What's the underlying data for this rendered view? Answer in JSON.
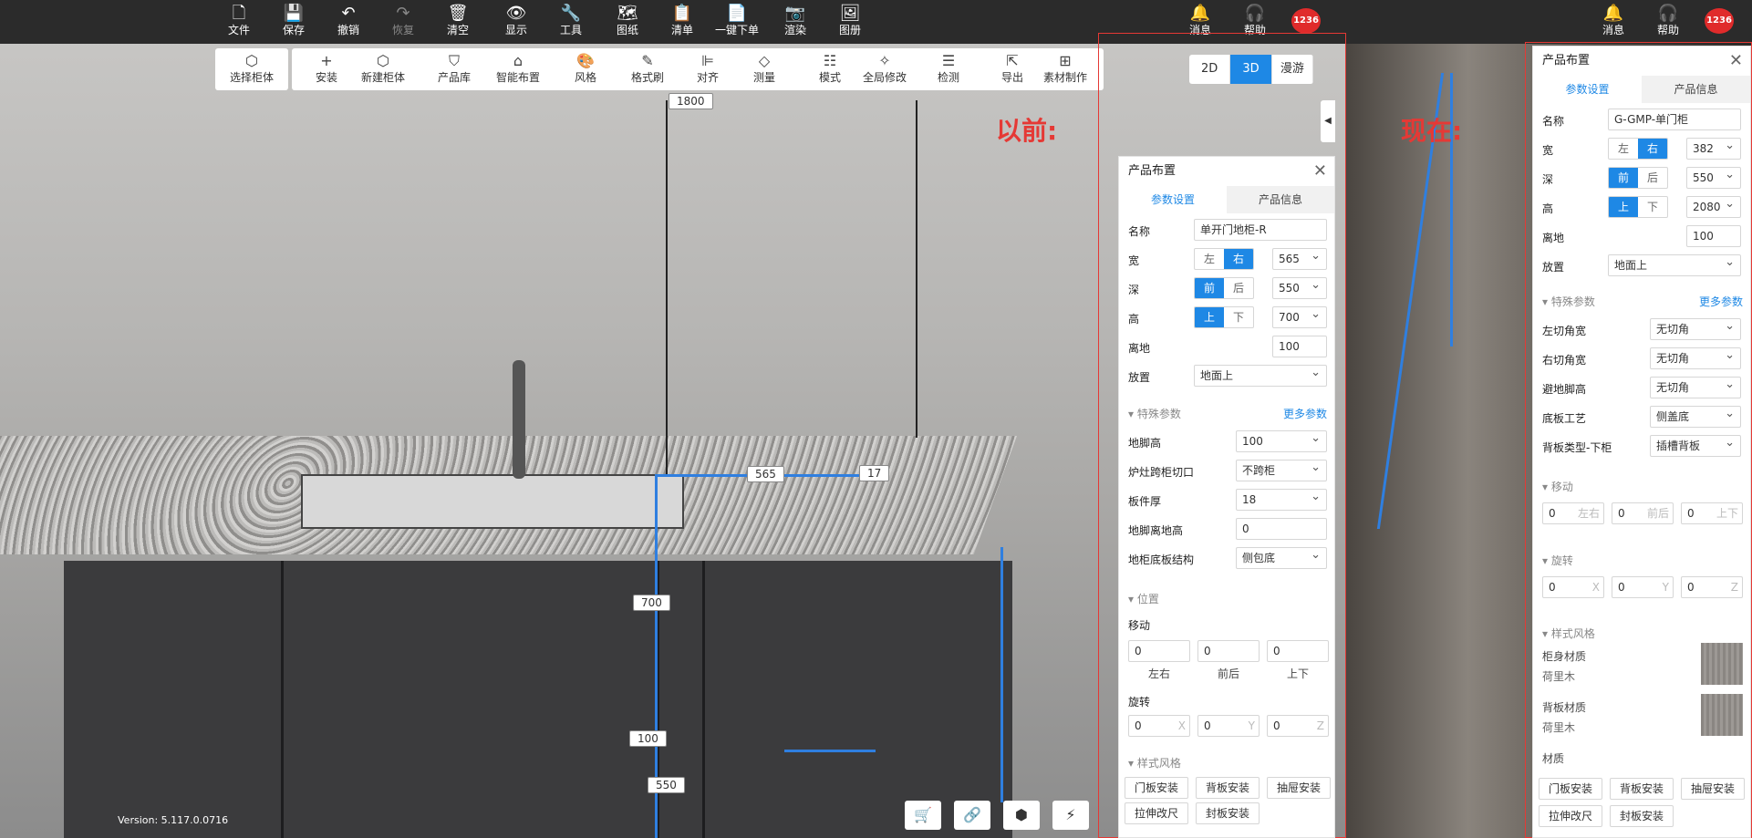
{
  "topbar": {
    "items": [
      {
        "label": "文件",
        "icon": "file-icon",
        "glyph": "🗋"
      },
      {
        "label": "保存",
        "icon": "save-icon",
        "glyph": "💾"
      },
      {
        "label": "撤销",
        "icon": "undo-icon",
        "glyph": "↶"
      },
      {
        "label": "恢复",
        "icon": "redo-icon",
        "glyph": "↷"
      },
      {
        "label": "清空",
        "icon": "trash-icon",
        "glyph": "🗑"
      },
      {
        "label": "显示",
        "icon": "eye-icon",
        "glyph": "👁"
      },
      {
        "label": "工具",
        "icon": "wrench-icon",
        "glyph": "🔧"
      },
      {
        "label": "图纸",
        "icon": "map-icon",
        "glyph": "🗺"
      },
      {
        "label": "清单",
        "icon": "clipboard-icon",
        "glyph": "📋"
      },
      {
        "label": "一键下单",
        "icon": "order-icon",
        "glyph": "📄"
      },
      {
        "label": "渲染",
        "icon": "camera-icon",
        "glyph": "📷"
      },
      {
        "label": "图册",
        "icon": "album-icon",
        "glyph": "🖼"
      }
    ],
    "right_left": [
      {
        "label": "消息",
        "icon": "bell-icon",
        "glyph": "🔔"
      },
      {
        "label": "帮助",
        "icon": "headset-icon",
        "glyph": "🎧"
      }
    ],
    "badge": "1236",
    "right_right": [
      {
        "label": "消息",
        "icon": "bell-icon",
        "glyph": "🔔"
      },
      {
        "label": "帮助",
        "icon": "headset-icon",
        "glyph": "🎧"
      }
    ],
    "badge2": "1236"
  },
  "subbar": {
    "select_cabinet": "选择柜体",
    "items": [
      "安装",
      "新建柜体",
      "产品库",
      "智能布置",
      "风格",
      "格式刷",
      "对齐",
      "测量",
      "模式",
      "全局修改",
      "检测",
      "导出",
      "素材制作"
    ],
    "glyphs": [
      "+",
      "⬡",
      "⛉",
      "⌂",
      "🎨",
      "✎",
      "⊫",
      "◇",
      "☷",
      "✧",
      "☰",
      "⇱",
      "⊞"
    ]
  },
  "view_toggle": {
    "options": [
      "2D",
      "3D",
      "漫游"
    ],
    "active": "3D"
  },
  "annotations": {
    "before": "以前:",
    "after": "现在:"
  },
  "dims": {
    "top": "1800",
    "width": "565",
    "small": "17",
    "height": "700",
    "ground": "100",
    "depth": "550"
  },
  "panel_old": {
    "title": "产品布置",
    "tabs": [
      "参数设置",
      "产品信息"
    ],
    "name_label": "名称",
    "name_value": "单开门地柜-R",
    "width_label": "宽",
    "width_seg": [
      "左",
      "右"
    ],
    "width_value": "565",
    "depth_label": "深",
    "depth_seg": [
      "前",
      "后"
    ],
    "depth_value": "550",
    "height_label": "高",
    "height_seg": [
      "上",
      "下"
    ],
    "height_value": "700",
    "ground_label": "离地",
    "ground_value": "100",
    "place_label": "放置",
    "place_value": "地面上",
    "special_title": "特殊参数",
    "more": "更多参数",
    "special": [
      {
        "k": "地脚高",
        "v": "100"
      },
      {
        "k": "炉灶跨柜切口",
        "v": "不跨柜"
      },
      {
        "k": "板件厚",
        "v": "18"
      },
      {
        "k": "地脚离地高",
        "v": "0"
      },
      {
        "k": "地柜底板结构",
        "v": "侧包底"
      }
    ],
    "position_title": "位置",
    "move_label": "移动",
    "move_values": [
      "0",
      "0",
      "0"
    ],
    "move_axes": [
      "左右",
      "前后",
      "上下"
    ],
    "rotate_label": "旋转",
    "rotate_values": [
      "0",
      "0",
      "0"
    ],
    "rotate_axes": [
      "X",
      "Y",
      "Z"
    ],
    "style_title": "样式风格",
    "buttons": [
      "门板安装",
      "背板安装",
      "抽屉安装",
      "拉伸改尺",
      "封板安装"
    ]
  },
  "panel_new": {
    "title": "产品布置",
    "tabs": [
      "参数设置",
      "产品信息"
    ],
    "name_label": "名称",
    "name_value": "G-GMP-单门柜",
    "width_label": "宽",
    "width_seg": [
      "左",
      "右"
    ],
    "width_value": "382",
    "depth_label": "深",
    "depth_seg": [
      "前",
      "后"
    ],
    "depth_value": "550",
    "height_label": "高",
    "height_seg": [
      "上",
      "下"
    ],
    "height_value": "2080",
    "ground_label": "离地",
    "ground_value": "100",
    "place_label": "放置",
    "place_value": "地面上",
    "special_title": "特殊参数",
    "more": "更多参数",
    "special": [
      {
        "k": "左切角宽",
        "v": "无切角"
      },
      {
        "k": "右切角宽",
        "v": "无切角"
      },
      {
        "k": "避地脚高",
        "v": "无切角"
      },
      {
        "k": "底板工艺",
        "v": "侧盖底"
      },
      {
        "k": "背板类型-下柜",
        "v": "插槽背板"
      }
    ],
    "move_title": "移动",
    "move_values": [
      "0",
      "0",
      "0"
    ],
    "move_axes": [
      "左右",
      "前后",
      "上下"
    ],
    "rotate_title": "旋转",
    "rotate_values": [
      "0",
      "0",
      "0"
    ],
    "rotate_axes": [
      "X",
      "Y",
      "Z"
    ],
    "style_title": "样式风格",
    "materials": [
      {
        "k": "柜身材质",
        "v": "荷里木"
      },
      {
        "k": "背板材质",
        "v": "荷里木"
      },
      {
        "k": "材质",
        "v": ""
      }
    ],
    "buttons": [
      "门板安装",
      "背板安装",
      "抽屉安装",
      "拉伸改尺",
      "封板安装"
    ]
  },
  "version": "Version: 5.117.0.0716"
}
